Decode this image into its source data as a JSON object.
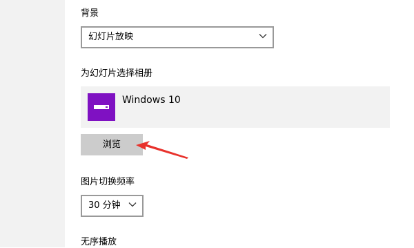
{
  "background_section": {
    "label": "背景",
    "dropdown_value": "幻灯片放映"
  },
  "album_section": {
    "label": "为幻灯片选择相册",
    "album_name": "Windows 10",
    "browse_label": "浏览"
  },
  "interval_section": {
    "label": "图片切换频率",
    "dropdown_value": "30 分钟"
  },
  "shuffle_section": {
    "label": "无序播放"
  },
  "colors": {
    "sidebar_bg": "#f2f2f2",
    "album_thumb": "#7f11c2",
    "button_bg": "#cccccc",
    "dropdown_border": "#999999",
    "annotation_arrow": "#e8322c"
  },
  "icons": {
    "dropdown_chevron": "chevron-down-icon",
    "album_thumbnail": "folder-album-icon",
    "annotation": "red-arrow-icon"
  }
}
